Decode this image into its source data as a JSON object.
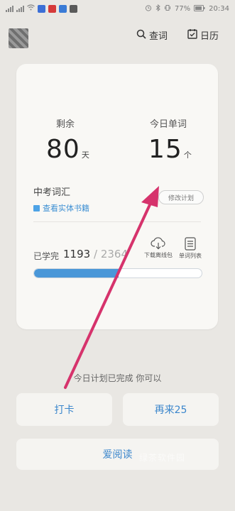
{
  "status_bar": {
    "battery": "77%",
    "time": "20:34"
  },
  "header": {
    "search_label": "查词",
    "calendar_label": "日历"
  },
  "stats": {
    "remaining_label": "剩余",
    "remaining_value": "80",
    "remaining_unit": "天",
    "today_label": "今日单词",
    "today_value": "15",
    "today_unit": "个"
  },
  "book": {
    "name": "中考词汇",
    "view_link": "查看实体书籍",
    "modify_plan": "修改计划"
  },
  "progress": {
    "learned_label": "已学完",
    "learned": "1193",
    "separator": "/",
    "total": "2364",
    "fraction": 0.5047,
    "download_label": "下载离线包",
    "wordlist_label": "单词列表"
  },
  "bottom": {
    "done_text": "今日计划已完成 你可以",
    "clock_in": "打卡",
    "again": "再来25",
    "read": "爱阅读"
  },
  "watermark": "绿茶软件园",
  "colors": {
    "accent_blue": "#4a97d8",
    "link_blue": "#3d8fd3",
    "arrow": "#d6336c"
  }
}
